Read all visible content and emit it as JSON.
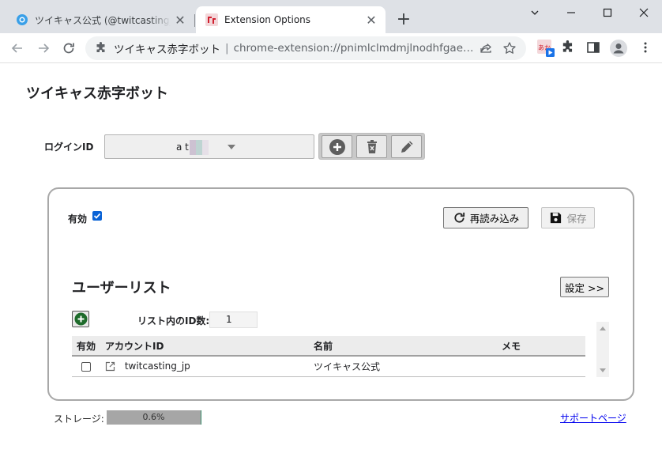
{
  "browser": {
    "tabs": [
      {
        "title": "ツイキャス公式 (@twitcasting_jp) さ",
        "active": false,
        "close": "✕"
      },
      {
        "title": "Extension Options",
        "active": true,
        "close": "✕"
      }
    ],
    "new_tab": "+",
    "omnibox": {
      "site_name": "ツイキャス赤字ボット",
      "divider": "|",
      "url": "chrome-extension://pnimlclmdmjlnodhfgaegpbnin..."
    },
    "extension_badge": "あか"
  },
  "page": {
    "title": "ツイキャス赤字ボット",
    "login": {
      "label": "ログインID",
      "selected_value": "a       t"
    },
    "panel": {
      "enabled_label": "有効",
      "enabled_checked": true,
      "reload_button": "再読み込み",
      "save_button": "保存",
      "user_list_title": "ユーザーリスト",
      "settings_button": "設定 >>",
      "id_count_label": "リスト内のID数:",
      "id_count_value": "1",
      "table": {
        "headers": [
          "有効",
          "アカウントID",
          "名前",
          "メモ"
        ],
        "rows": [
          {
            "enabled": false,
            "account_id": "twitcasting_jp",
            "name": "ツイキャス公式",
            "memo": ""
          }
        ]
      }
    },
    "storage": {
      "label": "ストレージ:",
      "percent_text": "0.6%",
      "percent": 0.6
    },
    "support_link": "サポートページ"
  },
  "colors": {
    "checkbox_blue": "#0a63d6",
    "add_icon_green": "#1e6b2b",
    "link_blue": "#0000ee"
  }
}
